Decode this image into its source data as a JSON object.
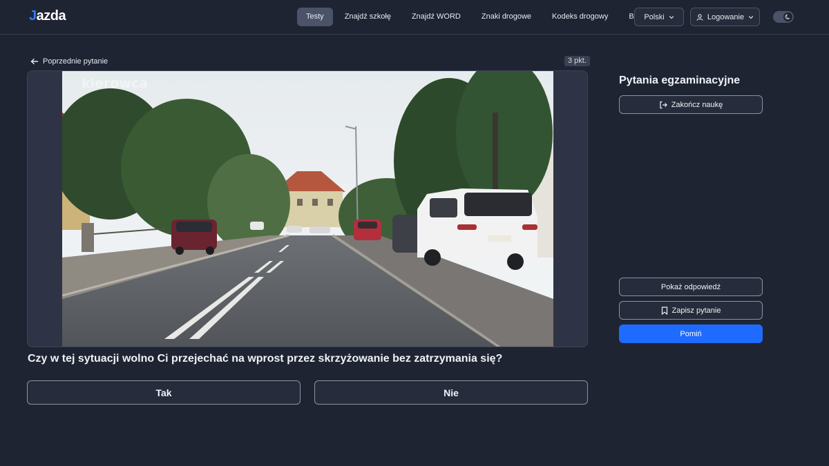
{
  "brand": {
    "logo_j": "J",
    "logo_rest": "azda"
  },
  "nav": {
    "items": [
      {
        "label": "Testy"
      },
      {
        "label": "Znajdź szkołę"
      },
      {
        "label": "Znajdź WORD"
      },
      {
        "label": "Znaki drogowe"
      },
      {
        "label": "Kodeks drogowy"
      },
      {
        "label": "Blog"
      }
    ],
    "language": "Polski",
    "login": "Logowanie"
  },
  "question": {
    "previous_label": "Poprzednie pytanie",
    "points": "3 pkt.",
    "media_watermark": "kierowca",
    "text": "Czy w tej sytuacji wolno Ci przejechać na wprost przez skrzyżowanie bez zatrzymania się?",
    "answers": [
      "Tak",
      "Nie"
    ]
  },
  "sidebar": {
    "title": "Pytania egzaminacyjne",
    "finish_label": "Zakończ naukę",
    "show_answer_label": "Pokaż odpowiedź",
    "save_label": "Zapisz pytanie",
    "skip_label": "Pomiń"
  },
  "colors": {
    "background": "#1f2433",
    "accent": "#1f6bff",
    "logo_accent": "#2e7bff"
  },
  "icons": [
    "arrow-left-icon",
    "chevron-down-icon",
    "user-icon",
    "moon-icon",
    "logout-icon",
    "bookmark-icon"
  ]
}
